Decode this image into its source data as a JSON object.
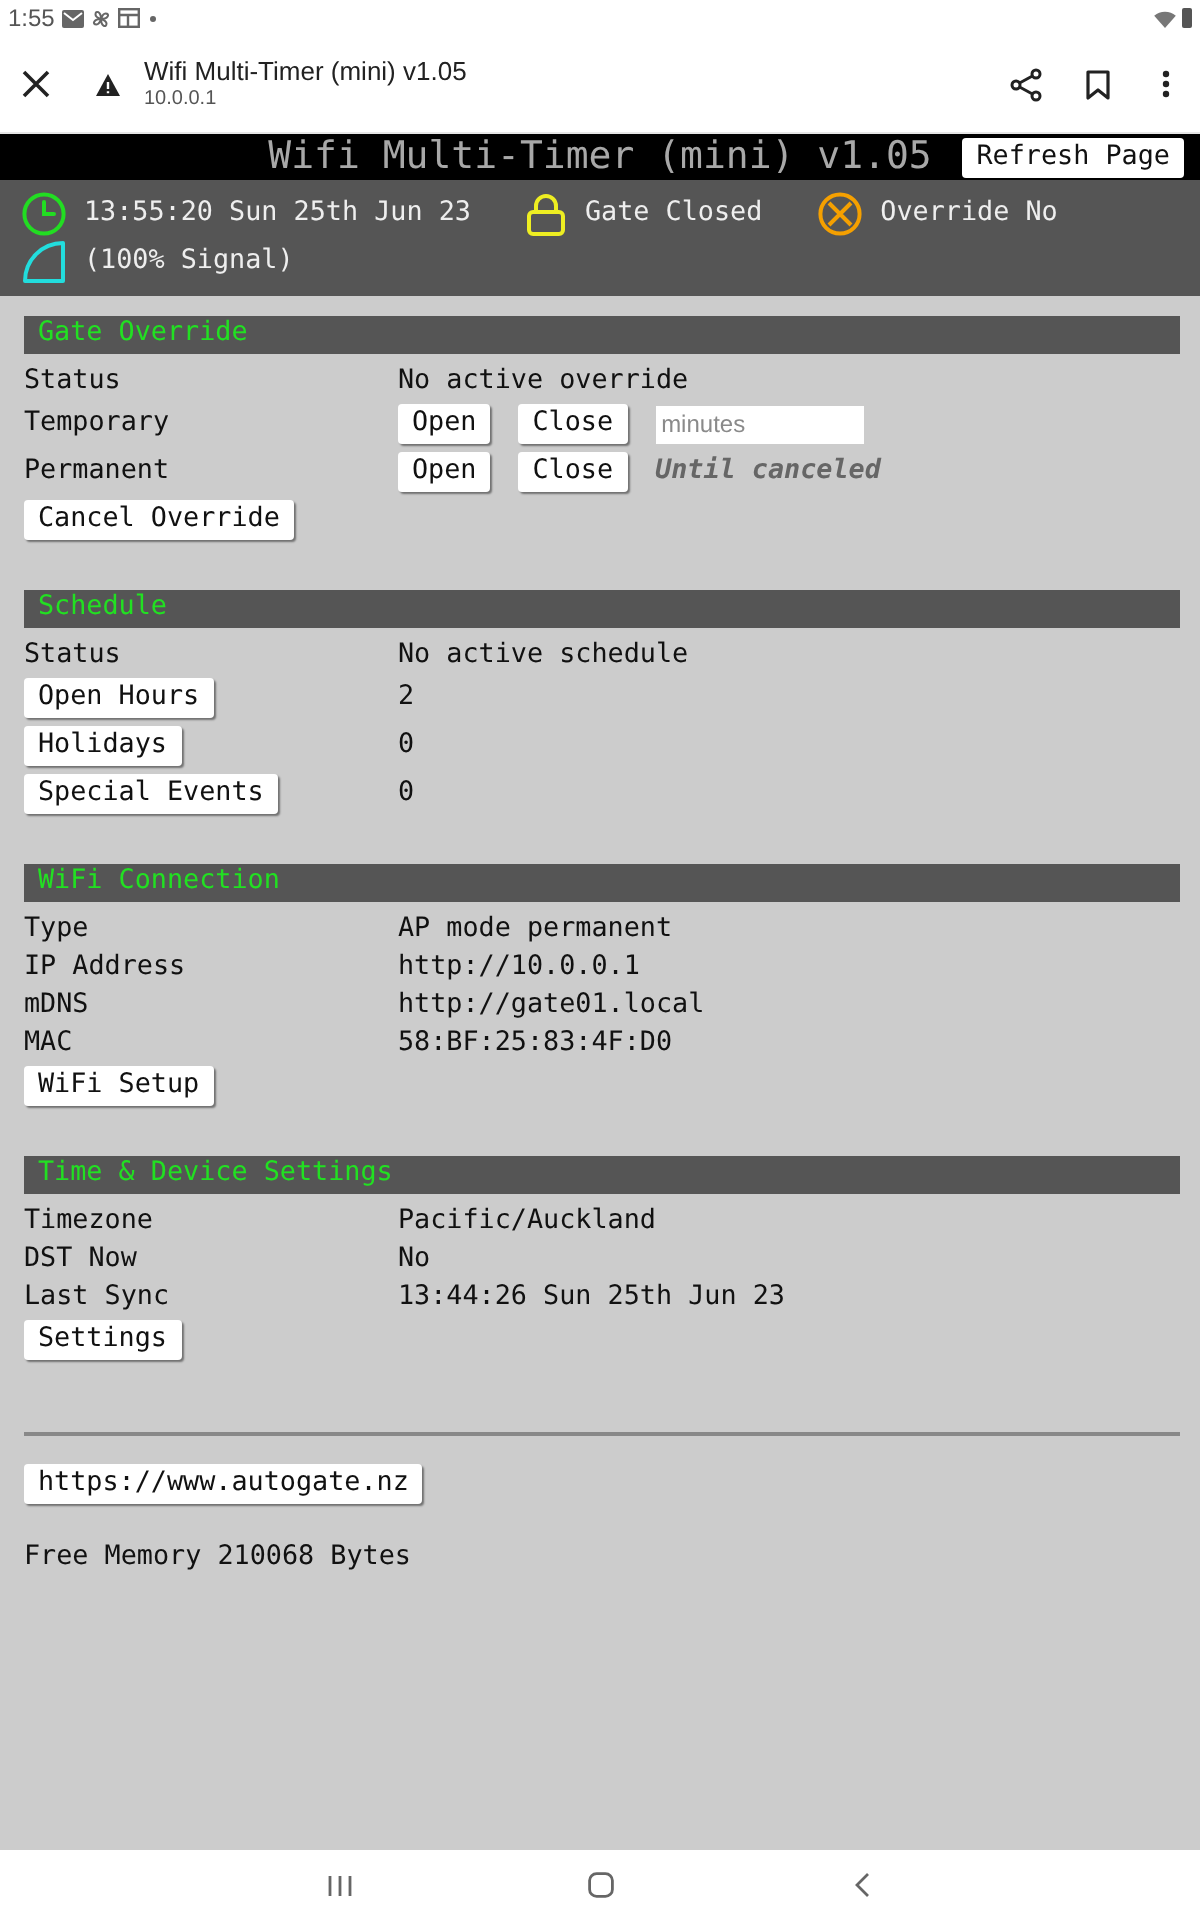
{
  "status_bar": {
    "time": "1:55"
  },
  "browser_bar": {
    "title": "Wifi Multi-Timer (mini) v1.05",
    "url": "10.0.0.1"
  },
  "header": {
    "title": "Wifi Multi-Timer (mini) v1.05",
    "refresh_button": "Refresh Page"
  },
  "info_bar": [
    {
      "kind": "clock",
      "text": "13:55:20 Sun 25th Jun 23"
    },
    {
      "kind": "gate",
      "text": "Gate Closed"
    },
    {
      "kind": "override",
      "text": "Override No"
    },
    {
      "kind": "signal",
      "text": "(100% Signal)"
    }
  ],
  "sections": [
    {
      "title": "Gate Override",
      "rows": [
        {
          "kind": "info",
          "label": "Status",
          "value": "No active override"
        },
        {
          "kind": "override",
          "label": "Temporary",
          "buttons": [
            "Open",
            "Close"
          ],
          "extra": {
            "kind": "input",
            "placeholder": "minutes"
          }
        },
        {
          "kind": "override",
          "label": "Permanent",
          "buttons": [
            "Open",
            "Close"
          ],
          "extra": {
            "kind": "note",
            "text": "Until canceled"
          }
        },
        {
          "kind": "button",
          "label": "Cancel Override"
        }
      ]
    },
    {
      "title": "Schedule",
      "rows": [
        {
          "kind": "info",
          "label": "Status",
          "value": "No active schedule"
        },
        {
          "kind": "button_value",
          "label": "Open Hours",
          "value": "2"
        },
        {
          "kind": "button_value",
          "label": "Holidays",
          "value": "0"
        },
        {
          "kind": "button_value",
          "label": "Special Events",
          "value": "0"
        }
      ]
    },
    {
      "title": "WiFi Connection",
      "rows": [
        {
          "kind": "info",
          "label": "Type",
          "value": "AP mode permanent"
        },
        {
          "kind": "info",
          "label": "IP Address",
          "value": "http://10.0.0.1"
        },
        {
          "kind": "info",
          "label": "mDNS",
          "value": "http://gate01.local"
        },
        {
          "kind": "info",
          "label": "MAC",
          "value": "58:BF:25:83:4F:D0"
        },
        {
          "kind": "button",
          "label": "WiFi Setup"
        }
      ]
    },
    {
      "title": "Time & Device Settings",
      "rows": [
        {
          "kind": "info",
          "label": "Timezone",
          "value": "Pacific/Auckland"
        },
        {
          "kind": "info",
          "label": "DST Now",
          "value": "No"
        },
        {
          "kind": "info",
          "label": "Last Sync",
          "value": "13:44:26 Sun 25th Jun 23"
        },
        {
          "kind": "button",
          "label": "Settings"
        }
      ]
    }
  ],
  "footer": {
    "link": "https://www.autogate.nz",
    "memory": "Free Memory 210068 Bytes"
  }
}
